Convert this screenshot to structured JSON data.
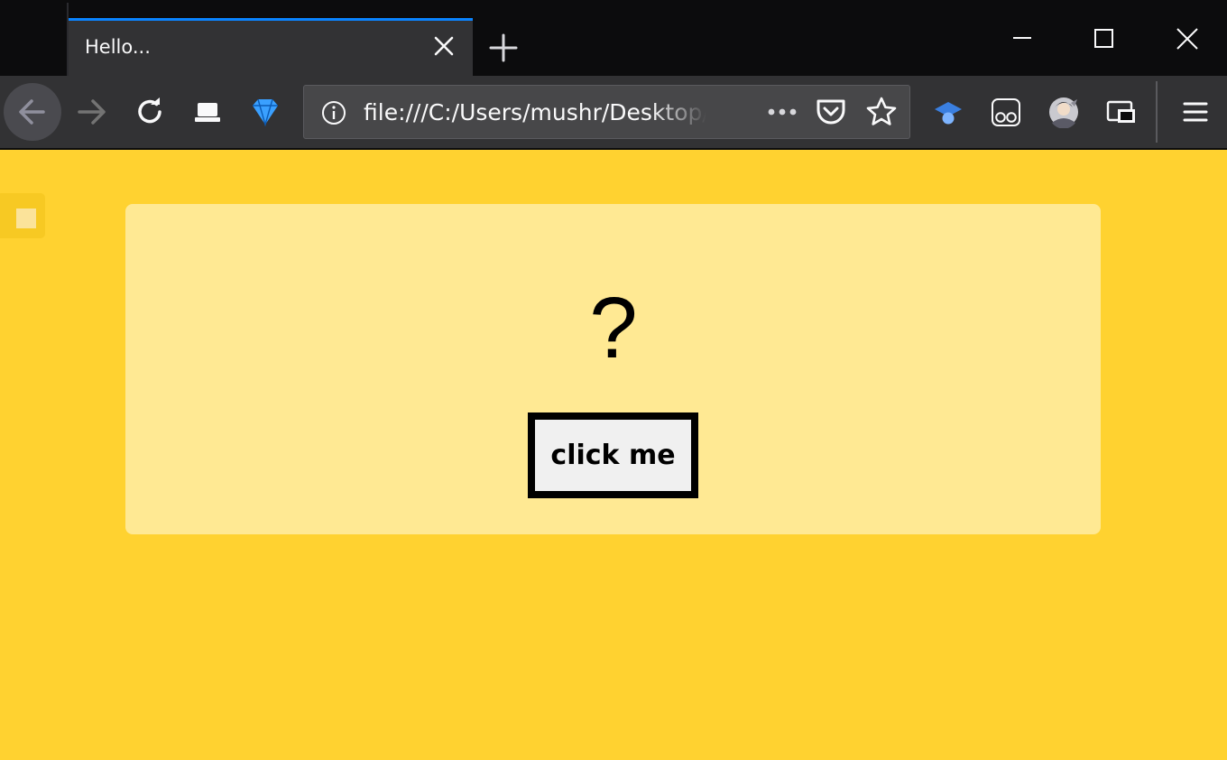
{
  "browser": {
    "tab": {
      "title": "Hello..."
    },
    "toolbar": {
      "url": "file:///C:/Users/mushr/Desktop/"
    }
  },
  "page": {
    "question": "?",
    "button_label": "click me",
    "background_color": "#ffd230",
    "card_color": "#ffe993"
  },
  "colors": {
    "tab_accent": "#0a84ff",
    "toolbar_bg": "#323234",
    "titlebar_bg": "#0c0c0d"
  },
  "icons": [
    "close-icon",
    "plus-icon",
    "minimize-icon",
    "maximize-icon",
    "back-arrow-icon",
    "forward-arrow-icon",
    "reload-icon",
    "laptop-icon",
    "diamond-icon",
    "info-icon",
    "more-dots-icon",
    "pocket-icon",
    "star-icon",
    "graduation-cap-icon",
    "glasses-icon",
    "avatar",
    "picture-in-picture-icon",
    "hamburger-menu-icon"
  ]
}
